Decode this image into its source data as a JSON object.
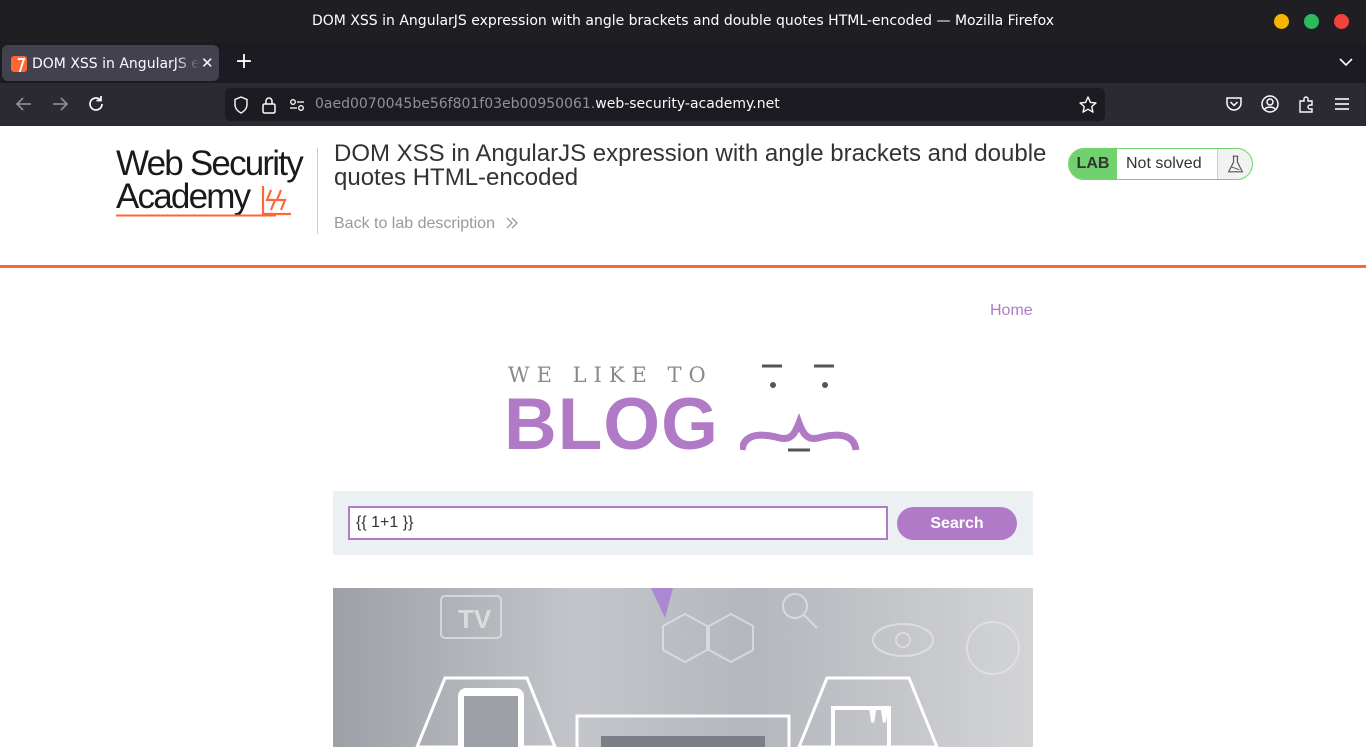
{
  "window": {
    "title": "DOM XSS in AngularJS expression with angle brackets and double quotes HTML-encoded — Mozilla Firefox"
  },
  "tabs": [
    {
      "title": "DOM XSS in AngularJS expression with angle brackets and double quotes HTML-encoded",
      "close_label": "✕"
    }
  ],
  "newtab_label": "+",
  "urlbar": {
    "url_prefix": "0aed0070045be56f801f03eb00950061.",
    "url_host": "web-security-academy.net"
  },
  "lab_header": {
    "logo_line1": "Web Security",
    "logo_line2": "Academy",
    "title": "DOM XSS in AngularJS expression with angle brackets and double quotes HTML-encoded",
    "back_link": "Back to lab description",
    "status_badge": "LAB",
    "status_text": "Not solved"
  },
  "blog": {
    "home_link": "Home",
    "banner_tagline": "WE LIKE TO",
    "banner_word": "BLOG",
    "search_value": "{{ 1+1 }}",
    "search_button": "Search"
  },
  "colors": {
    "accent_orange": "#ff6633",
    "accent_purple": "#b07ac6",
    "lab_green": "#70d16d",
    "chrome_dark": "#1f1f23"
  }
}
